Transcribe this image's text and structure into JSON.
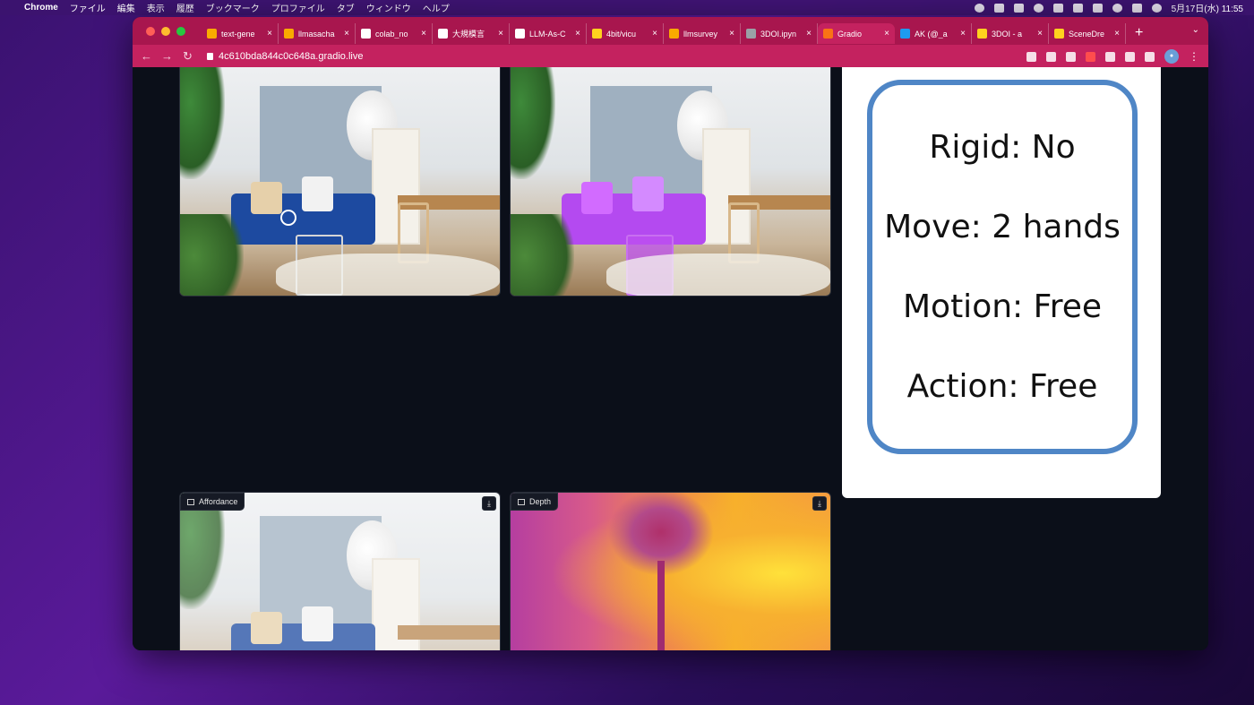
{
  "menubar": {
    "app": "Chrome",
    "items": [
      "ファイル",
      "編集",
      "表示",
      "履歴",
      "ブックマーク",
      "プロファイル",
      "タブ",
      "ウィンドウ",
      "ヘルプ"
    ],
    "datetime": "5月17日(水)  11:55"
  },
  "tabs": [
    {
      "label": "text-gene",
      "icon": "colab-icon",
      "color": "#f9ab00"
    },
    {
      "label": "llmasacha",
      "icon": "colab-icon",
      "color": "#f9ab00"
    },
    {
      "label": "colab_no",
      "icon": "github-icon",
      "color": "#ffffff"
    },
    {
      "label": "大規模言",
      "icon": "notion-icon",
      "color": "#ffffff"
    },
    {
      "label": "LLM-As-C",
      "icon": "github-icon",
      "color": "#ffffff"
    },
    {
      "label": "4bit/vicu",
      "icon": "huggingface-icon",
      "color": "#ffd21e"
    },
    {
      "label": "llmsurvey",
      "icon": "colab-icon",
      "color": "#f9ab00"
    },
    {
      "label": "3DOI.ipyn",
      "icon": "colab-icon",
      "color": "#9aa0a6"
    },
    {
      "label": "Gradio",
      "icon": "gradio-icon",
      "color": "#f97316",
      "active": true
    },
    {
      "label": "AK (@_a",
      "icon": "twitter-icon",
      "color": "#1d9bf0"
    },
    {
      "label": "3DOI - a",
      "icon": "huggingface-icon",
      "color": "#ffd21e"
    },
    {
      "label": "SceneDre",
      "icon": "huggingface-icon",
      "color": "#ffd21e"
    }
  ],
  "address": {
    "url": "4c610bda844c0c648a.gradio.live"
  },
  "panels": {
    "properties": {
      "lines": [
        "Rigid: No",
        "Move: 2 hands",
        "Motion: Free",
        "Action: Free"
      ]
    },
    "affordance": {
      "label": "Affordance"
    },
    "depth": {
      "label": "Depth"
    }
  },
  "colors": {
    "tabbar": "#a8164e",
    "addressbar": "#c4225f",
    "background": "#0b0f19",
    "card_border": "#4f86c6"
  }
}
